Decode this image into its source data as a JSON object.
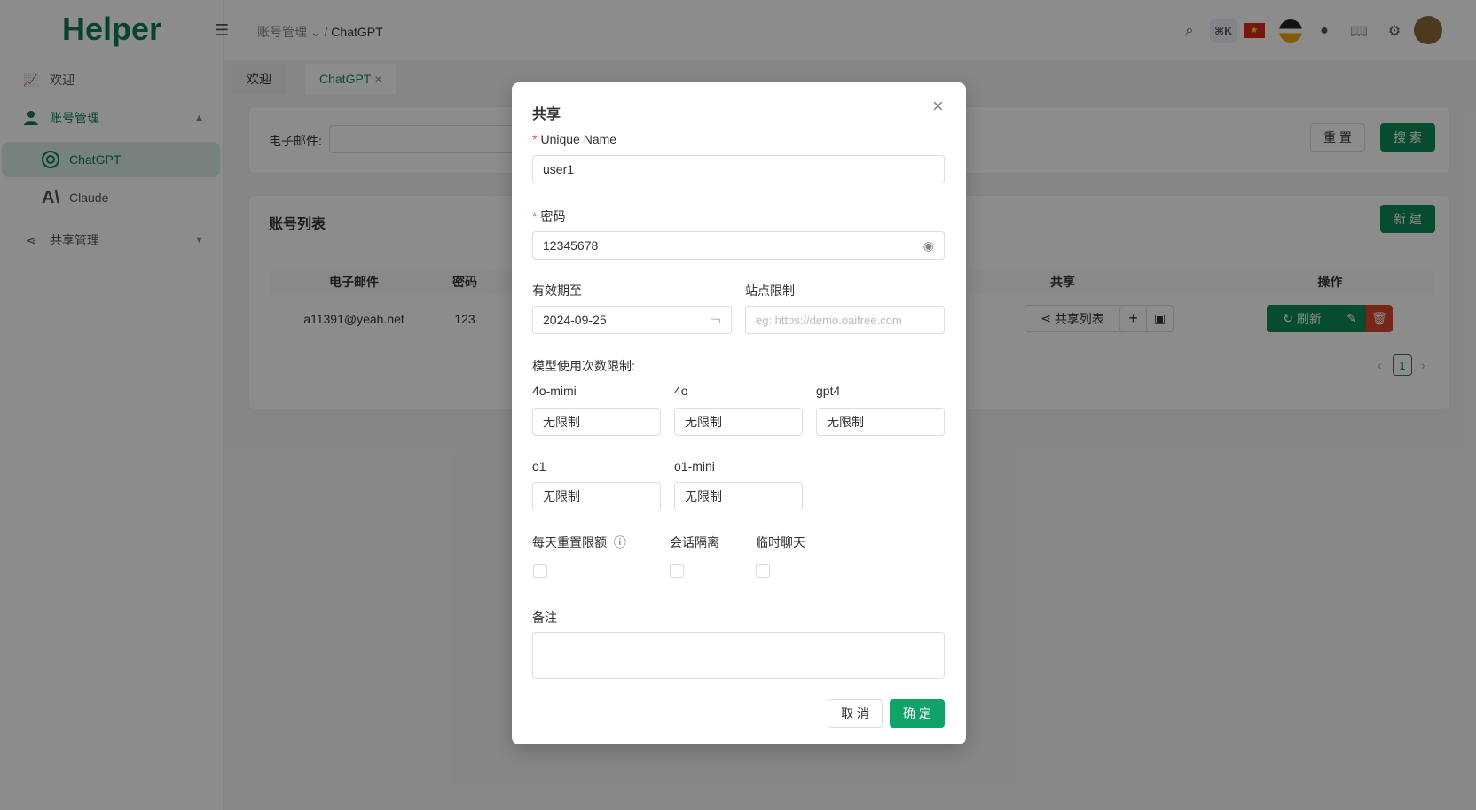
{
  "app": {
    "logo": "Helper"
  },
  "sidebar": {
    "items": [
      {
        "label": "欢迎",
        "icon": "chart-icon"
      },
      {
        "label": "账号管理",
        "icon": "user-icon"
      },
      {
        "label": "ChatGPT",
        "icon": "openai-icon"
      },
      {
        "label": "Claude",
        "icon": "anthropic-icon"
      },
      {
        "label": "共享管理",
        "icon": "share-icon"
      }
    ]
  },
  "header": {
    "breadcrumb": [
      "账号管理",
      "ChatGPT"
    ],
    "shortcut": "⌘K"
  },
  "tabs": [
    {
      "label": "欢迎"
    },
    {
      "label": "ChatGPT",
      "active": true
    }
  ],
  "search": {
    "email_label": "电子邮件:",
    "reset": "重 置",
    "search": "搜 索"
  },
  "list": {
    "title": "账号列表",
    "new": "新 建",
    "columns": [
      "电子邮件",
      "密码",
      "共享",
      "操作"
    ],
    "rows": [
      {
        "email": "a11391@yeah.net",
        "password": "123",
        "share_list": "共享列表",
        "refresh": "刷新"
      }
    ],
    "page": "1"
  },
  "modal": {
    "title": "共享",
    "unique_name_label": "Unique Name",
    "unique_name": "user1",
    "password_label": "密码",
    "password": "12345678",
    "expiry_label": "有效期至",
    "expiry": "2024-09-25",
    "site_label": "站点限制",
    "site_placeholder": "eg: https://demo.oaifree.com",
    "model_limit_label": "模型使用次数限制:",
    "models": [
      {
        "name": "4o-mimi",
        "placeholder": "无限制"
      },
      {
        "name": "4o",
        "placeholder": "无限制"
      },
      {
        "name": "gpt4",
        "placeholder": "无限制"
      },
      {
        "name": "o1",
        "placeholder": "无限制"
      },
      {
        "name": "o1-mini",
        "placeholder": "无限制"
      }
    ],
    "checks": [
      {
        "label": "每天重置限额"
      },
      {
        "label": "会话隔离"
      },
      {
        "label": "临时聊天"
      }
    ],
    "note_label": "备注",
    "cancel": "取 消",
    "ok": "确 定"
  },
  "colors": {
    "brand": "#0f8a57",
    "danger": "#d9452b"
  }
}
